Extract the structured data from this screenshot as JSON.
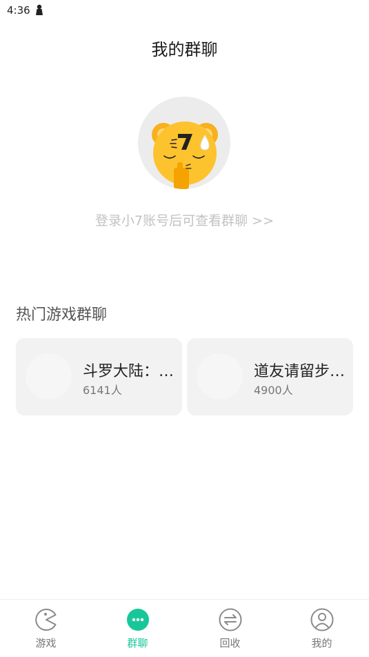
{
  "status_bar": {
    "time": "4:36"
  },
  "header": {
    "title": "我的群聊"
  },
  "login": {
    "prompt": "登录小7账号后可查看群聊 >>"
  },
  "hot_section": {
    "title": "热门游戏群聊",
    "groups": [
      {
        "name": "斗罗大陆：…",
        "count": "6141人"
      },
      {
        "name": "道友请留步…",
        "count": "4900人"
      }
    ]
  },
  "tab_bar": {
    "accent_color": "#17c79a",
    "items": [
      {
        "label": "游戏",
        "icon": "pacman-icon",
        "active": false
      },
      {
        "label": "群聊",
        "icon": "chat-bubble-icon",
        "active": true
      },
      {
        "label": "回收",
        "icon": "exchange-arrows-icon",
        "active": false
      },
      {
        "label": "我的",
        "icon": "user-profile-icon",
        "active": false
      }
    ]
  }
}
